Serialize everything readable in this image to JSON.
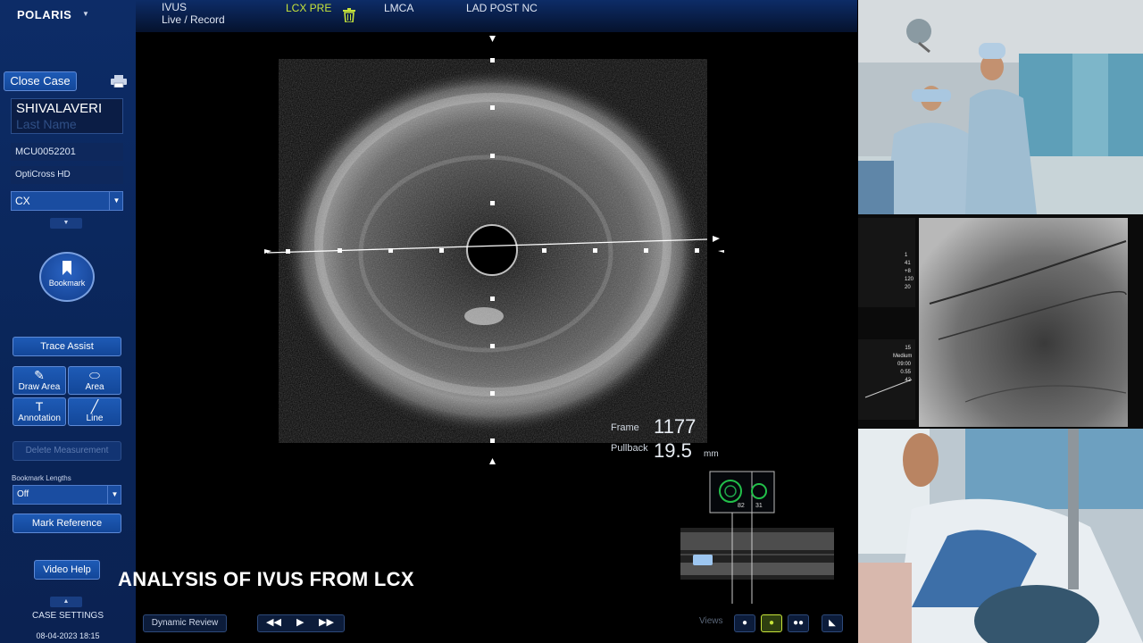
{
  "sidebar": {
    "brand": "POLARIS",
    "close_case": "Close Case",
    "patient_first": "SHIVALAVERI",
    "patient_last_placeholder": "Last Name",
    "patient_id": "MCU0052201",
    "catheter": "OptiCross HD",
    "vessel": "CX",
    "bookmark": "Bookmark",
    "trace_assist": "Trace Assist",
    "tools": [
      {
        "label": "Draw Area",
        "icon": "draw-area-icon"
      },
      {
        "label": "Area",
        "icon": "area-icon"
      },
      {
        "label": "Annotation",
        "icon": "annotation-icon"
      },
      {
        "label": "Line",
        "icon": "line-icon"
      }
    ],
    "delete_measurement": "Delete Measurement",
    "bookmark_lengths_label": "Bookmark Lengths",
    "bookmark_lengths_value": "Off",
    "mark_reference": "Mark Reference",
    "video_help": "Video Help",
    "case_settings": "CASE SETTINGS",
    "datetime": "08-04-2023 18:15"
  },
  "topbar": {
    "mode_line1": "IVUS",
    "mode_line2": "Live / Record",
    "tabs": [
      "LCX PRE",
      "LMCA",
      "LAD POST NC"
    ],
    "active_tab": "LCX PRE",
    "active_color": "#c6e33a"
  },
  "ivus": {
    "frame_label": "Frame",
    "frame_value": "1177",
    "pullback_label": "Pullback",
    "pullback_value": "19.5",
    "pullback_unit": "mm",
    "minimap_left": "82",
    "minimap_right": "31"
  },
  "caption": "ANALYSIS OF IVUS FROM LCX",
  "bottombar": {
    "dynamic_review": "Dynamic Review",
    "views_label": "Views"
  },
  "angio": {
    "info_top": [
      "1",
      "41",
      "+8",
      "120",
      "20"
    ],
    "info_bottom": [
      "15",
      "Medium",
      "09:00",
      "0.55",
      "42"
    ]
  }
}
